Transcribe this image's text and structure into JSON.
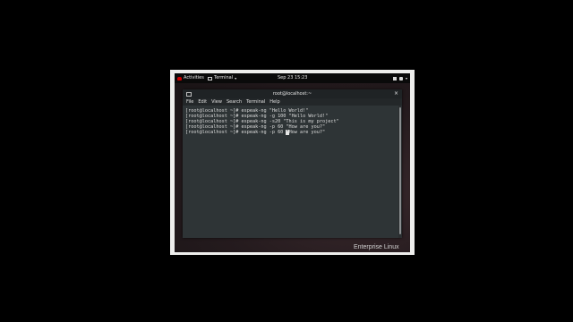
{
  "topbar": {
    "activities_label": "Activities",
    "app_label": "Terminal",
    "clock": "Sep 23  15:23"
  },
  "terminal": {
    "title": "root@localhost:~",
    "close_glyph": "×",
    "menu": [
      "File",
      "Edit",
      "View",
      "Search",
      "Terminal",
      "Help"
    ],
    "lines": [
      "[root@localhost ~]# espeak-ng \"Hello World!\"",
      "[root@localhost ~]# espeak-ng -g 100 \"Hello World!\"",
      "[root@localhost ~]# espeak-ng -s20 \"This is my project\"",
      "[root@localhost ~]# espeak-ng -p 60 \"How are you?\"",
      "[root@localhost ~]# espeak-ng -p 60 "
    ],
    "cursor_char": "\"",
    "last_line_tail": "How are you?\""
  },
  "desktop": {
    "brand_text": "Enterprise Linux"
  },
  "colors": {
    "accent_red": "#cc0000",
    "terminal_bg": "#2e3436"
  },
  "icons": [
    "red-hat-icon",
    "terminal-icon",
    "dropdown-arrow-icon",
    "network-icon",
    "volume-icon",
    "power-icon",
    "window-icon",
    "close-icon"
  ]
}
